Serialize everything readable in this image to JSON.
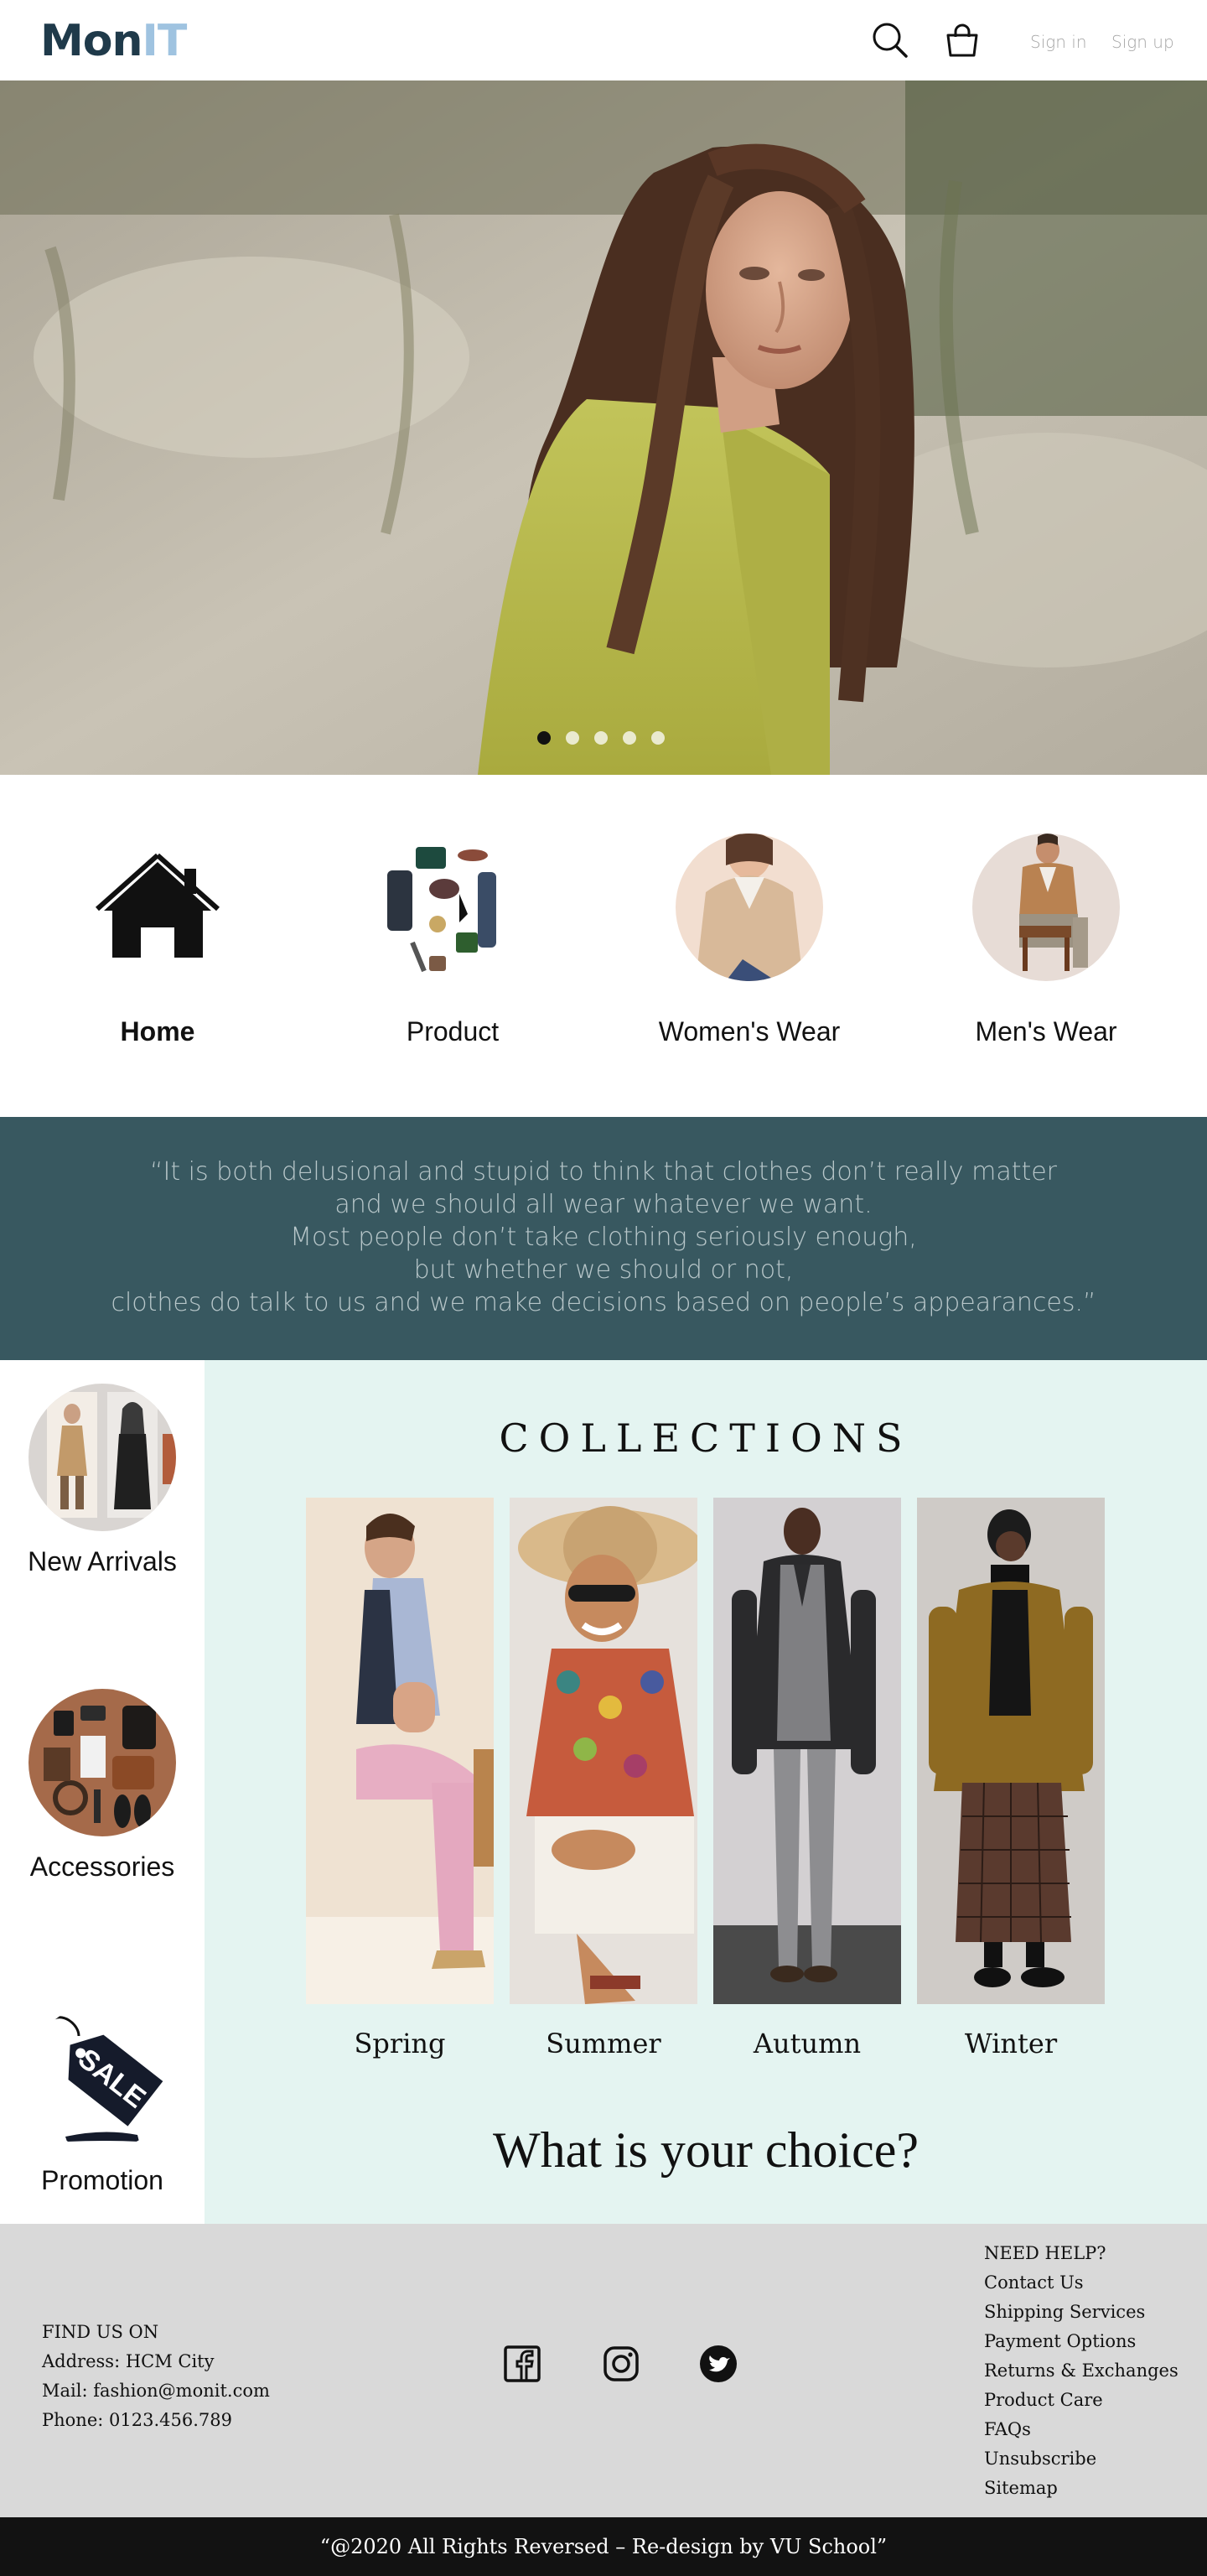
{
  "header": {
    "logo_part1": "Mon",
    "logo_part2": "IT",
    "sign_in": "Sign in",
    "sign_up": "Sign up",
    "icons": [
      "search-icon",
      "shopping-bag-icon"
    ]
  },
  "hero": {
    "slide_count": 5,
    "active_slide": 1
  },
  "categories": [
    {
      "label": "Home",
      "icon": "home-icon"
    },
    {
      "label": "Product"
    },
    {
      "label": "Women's Wear"
    },
    {
      "label": "Men's Wear"
    }
  ],
  "quote": {
    "lines": [
      "“It is both delusional and stupid to think that clothes don’t really matter",
      "and we should all wear whatever we want.",
      "Most people don’t take clothing seriously enough,",
      "but whether we should or not,",
      "clothes do talk to us and we make decisions based on people’s appearances.”"
    ]
  },
  "sidebar": {
    "items": [
      {
        "label": "New Arrivals"
      },
      {
        "label": "Accessories"
      },
      {
        "label": "Promotion",
        "tag_text": "SALE"
      }
    ]
  },
  "collections": {
    "title": "COLLECTIONS",
    "seasons": [
      {
        "label": "Spring"
      },
      {
        "label": "Summer"
      },
      {
        "label": "Autumn"
      },
      {
        "label": "Winter"
      }
    ],
    "tagline": "What is your choice?"
  },
  "footer": {
    "find": {
      "heading": "FIND US ON",
      "address": "Address: HCM City",
      "mail": "Mail: fashion@monit.com",
      "phone": "Phone: 0123.456.789"
    },
    "social_icons": [
      "facebook-icon",
      "instagram-icon",
      "twitter-icon"
    ],
    "help": {
      "heading": "NEED HELP?",
      "items": [
        "Contact Us",
        "Shipping Services",
        "Payment Options",
        "Returns & Exchanges",
        "Product Care",
        "FAQs",
        "Unsubscribe",
        "Sitemap"
      ]
    },
    "copyright": "“@2020 All Rights Reversed – Re-design by VU School”"
  },
  "colors": {
    "quote_bg": "#385860",
    "collections_bg": "#e4f4f1",
    "footer_bg": "#d9d9d9",
    "bottom_bar_bg": "#121212"
  }
}
